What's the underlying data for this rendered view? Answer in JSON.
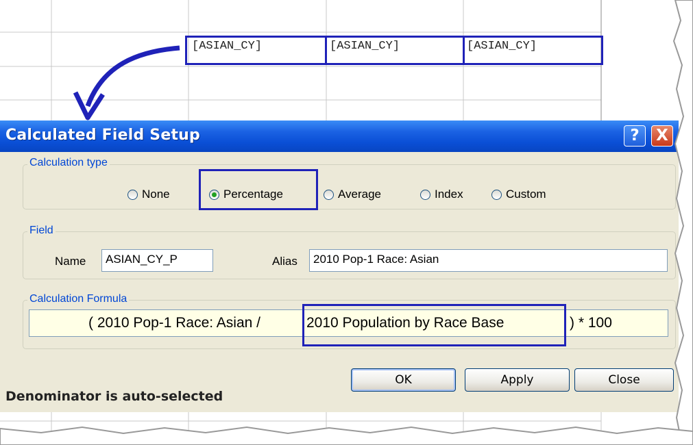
{
  "spreadsheet": {
    "cells": [
      "[ASIAN_CY]",
      "[ASIAN_CY]",
      "[ASIAN_CY]"
    ]
  },
  "dialog": {
    "title": "Calculated Field Setup",
    "help_label": "?",
    "close_label": "X",
    "calc_type": {
      "legend": "Calculation type",
      "options": [
        "None",
        "Percentage",
        "Average",
        "Index",
        "Custom"
      ],
      "selected": "Percentage"
    },
    "field": {
      "legend": "Field",
      "name_label": "Name",
      "name_value": "ASIAN_CY_P",
      "alias_label": "Alias",
      "alias_value": "2010 Pop-1 Race: Asian"
    },
    "formula": {
      "legend": "Calculation Formula",
      "part1": "( 2010 Pop-1 Race: Asian /",
      "part2": "2010 Population by Race Base",
      "part3": ") * 100"
    },
    "buttons": {
      "ok": "OK",
      "apply": "Apply",
      "close": "Close"
    }
  },
  "annotation": {
    "note": "Denominator is auto-selected",
    "highlight_color": "#1f22b8"
  }
}
